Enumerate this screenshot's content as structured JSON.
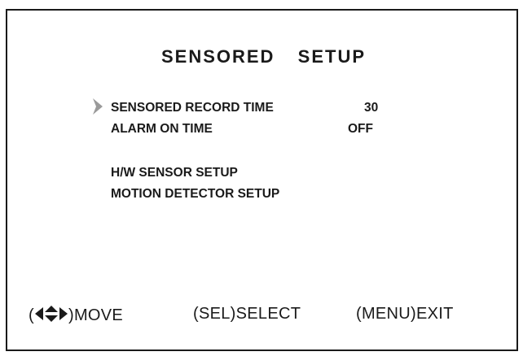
{
  "title": "SENSORED  SETUP",
  "menu": {
    "items": [
      {
        "label": "SENSORED RECORD TIME",
        "value": "30"
      },
      {
        "label": "ALARM ON TIME",
        "value": "OFF"
      },
      {
        "label": "H/W SENSOR SETUP"
      },
      {
        "label": "MOTION DETECTOR SETUP"
      }
    ],
    "selected_index": 0
  },
  "footer": {
    "move": {
      "open": "(",
      "close": ")",
      "label": "MOVE"
    },
    "select": {
      "key": "(SEL)",
      "label": "SELECT"
    },
    "exit": {
      "key": "(MENU)",
      "label": "EXIT"
    }
  },
  "icons": {
    "cursor": "chevron-right-icon",
    "move": "four-way-arrows-icon"
  },
  "colors": {
    "text": "#1a1a1a",
    "background": "#ffffff",
    "cursor": "#9a9a9a"
  }
}
